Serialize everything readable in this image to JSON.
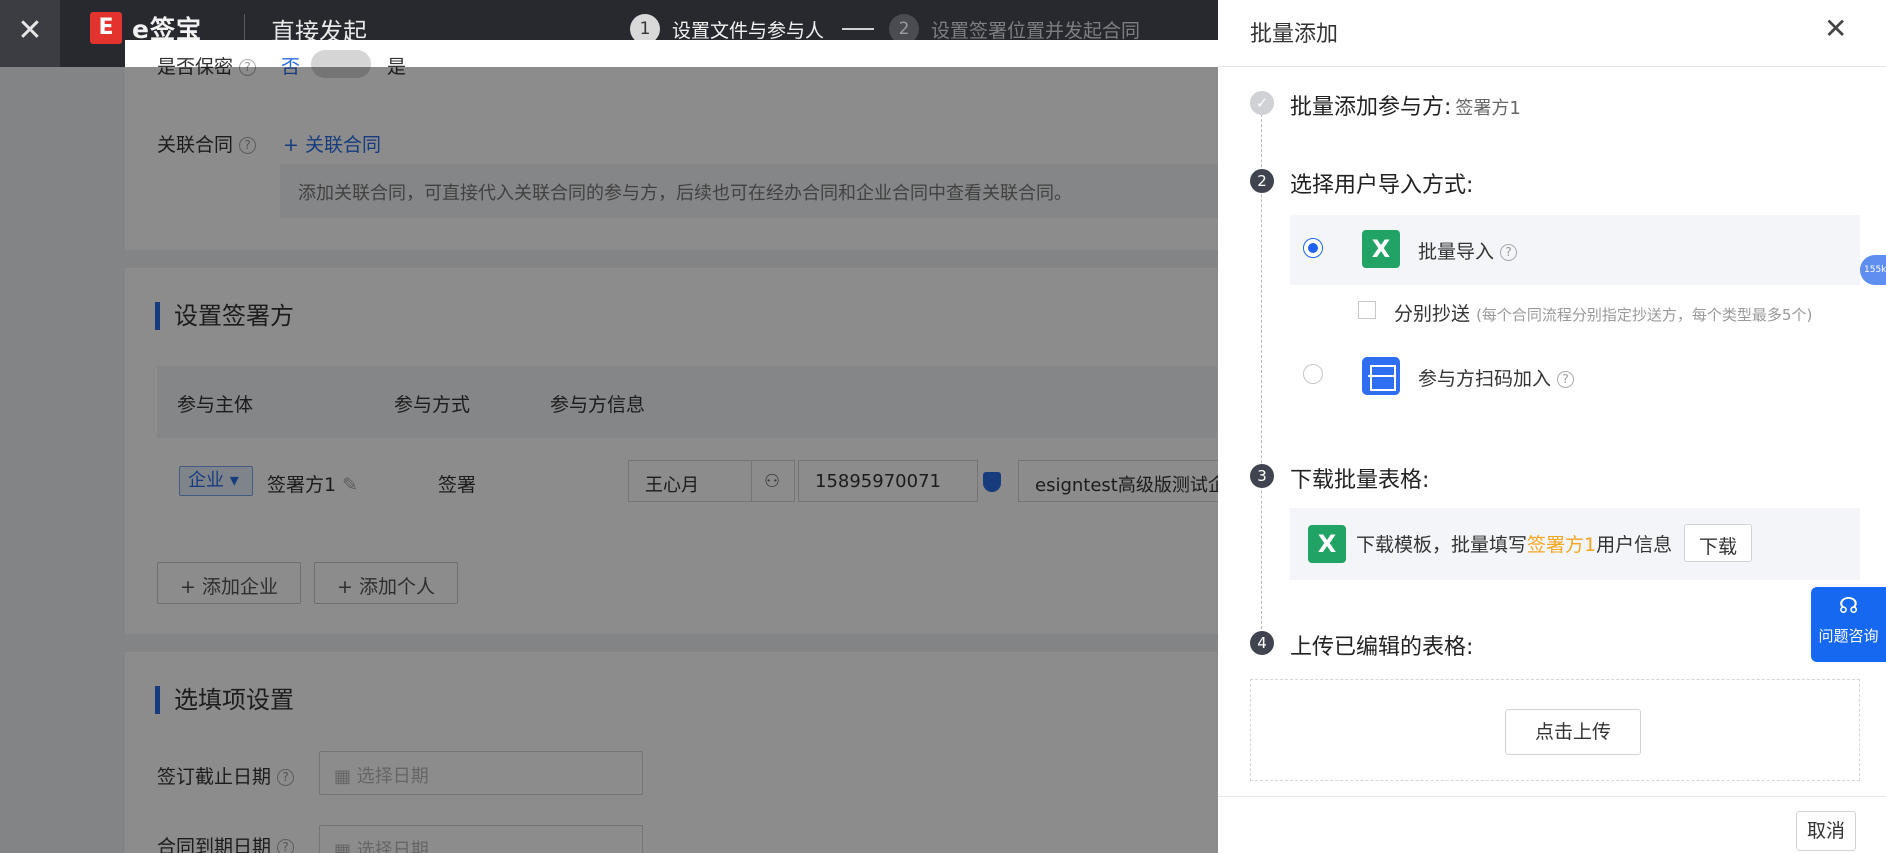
{
  "topbar": {
    "close_glyph": "✕",
    "logo_mark": "E",
    "logo_text": "e签宝",
    "title": "直接发起",
    "steps": [
      {
        "num": "1",
        "label": "设置文件与参与人",
        "active": true
      },
      {
        "num": "2",
        "label": "设置签署位置并发起合同",
        "active": false
      }
    ]
  },
  "background": {
    "confidential_label": "是否保密",
    "confidential_no": "否",
    "confidential_yes": "是",
    "related_label": "关联合同",
    "related_link": "+ 关联合同",
    "related_hint": "添加关联合同，可直接代入关联合同的参与方，后续也可在经办合同和企业合同中查看关联合同。",
    "signers_title": "设置签署方",
    "table_headers": [
      "参与主体",
      "参与方式",
      "参与方信息"
    ],
    "row": {
      "entity_type": "企业",
      "party_name": "签署方1",
      "method": "签署",
      "contact_name": "王心月",
      "phone": "15895970071",
      "company": "esigntest高级版测试企"
    },
    "add_company": "+ 添加企业",
    "add_person": "+ 添加个人",
    "optional_title": "选填项设置",
    "deadline_label": "签订截止日期",
    "expire_label": "合同到期日期",
    "date_placeholder": "选择日期"
  },
  "drawer": {
    "title": "批量添加",
    "close_glyph": "✕",
    "step1": {
      "title": "批量添加参与方:",
      "value": "签署方1"
    },
    "step2": {
      "num": "2",
      "title": "选择用户导入方式:",
      "option_batch": "批量导入",
      "cc_label": "分别抄送",
      "cc_note": "(每个合同流程分别指定抄送方，每个类型最多5个)",
      "option_scan": "参与方扫码加入"
    },
    "step3": {
      "num": "3",
      "title": "下载批量表格:",
      "text_before": "下载模板，批量填写",
      "highlight": "签署方1",
      "text_after": "用户信息",
      "download_button": "下载"
    },
    "step4": {
      "num": "4",
      "title": "上传已编辑的表格:",
      "upload_button": "点击上传"
    },
    "cancel_button": "取消"
  },
  "side": {
    "badge": "155k",
    "consult_label": "问题咨询"
  },
  "colors": {
    "primary": "#1f64f0",
    "excel": "#21a366",
    "highlight": "#f5a623",
    "topbar": "#27292f"
  }
}
